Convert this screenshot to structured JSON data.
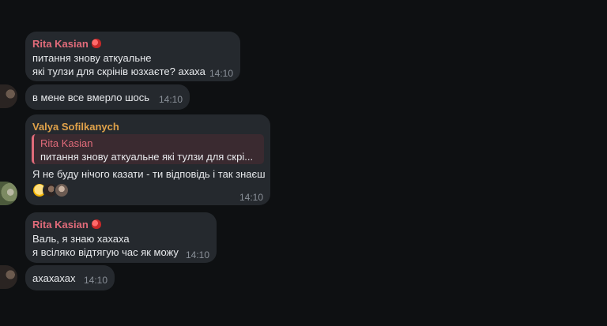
{
  "messages": [
    {
      "sender": "Rita Kasian",
      "lines": [
        "питання знову аткуальне",
        "які тулзи для скрінів юзхаєте? ахаха"
      ],
      "time": "14:10"
    },
    {
      "lines": [
        "в мене все вмерло шось"
      ],
      "time": "14:10"
    },
    {
      "sender": "Valya Sofilkanych",
      "reply": {
        "sender": "Rita Kasian",
        "text": "питання знову аткуальне які тулзи для скрі..."
      },
      "lines": [
        "Я не буду нічого казати - ти відповідь і так знаєш"
      ],
      "reactions": [
        "grinning-emoji",
        "avatar",
        "avatar"
      ],
      "time": "14:10"
    },
    {
      "sender": "Rita Kasian",
      "lines": [
        "Валь, я знаю хахаха",
        "я всіляко відтягую час як можу"
      ],
      "time": "14:10"
    },
    {
      "lines": [
        "ахахахах"
      ],
      "time": "14:10"
    }
  ],
  "colors": {
    "background": "#0e1012",
    "bubble": "#25292e",
    "rita_name": "#e16b7a",
    "valya_name": "#e0a24a",
    "timestamp": "#8a9098"
  }
}
